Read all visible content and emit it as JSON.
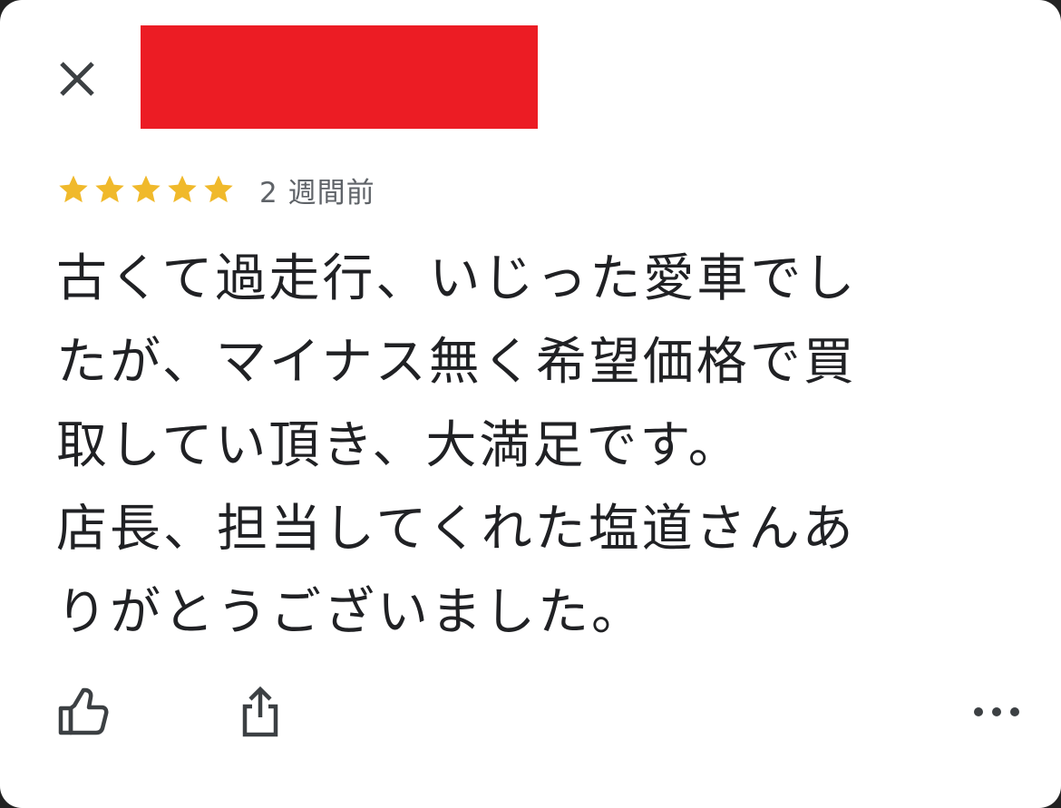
{
  "header": {
    "close_icon": "close-icon"
  },
  "review": {
    "rating": 5,
    "rating_max": 5,
    "star_color": "#f0b92b",
    "time_ago": "2 週間前",
    "text": "古くて過走行、いじった愛車でし\nたが、マイナス無く希望価格で買\n取してい頂き、大満足です。\n店長、担当してくれた塩道さんあ\nりがとうございました。"
  },
  "actions": {
    "like_icon": "thumbs-up-icon",
    "share_icon": "share-icon",
    "more_icon": "more-horizontal-icon"
  }
}
